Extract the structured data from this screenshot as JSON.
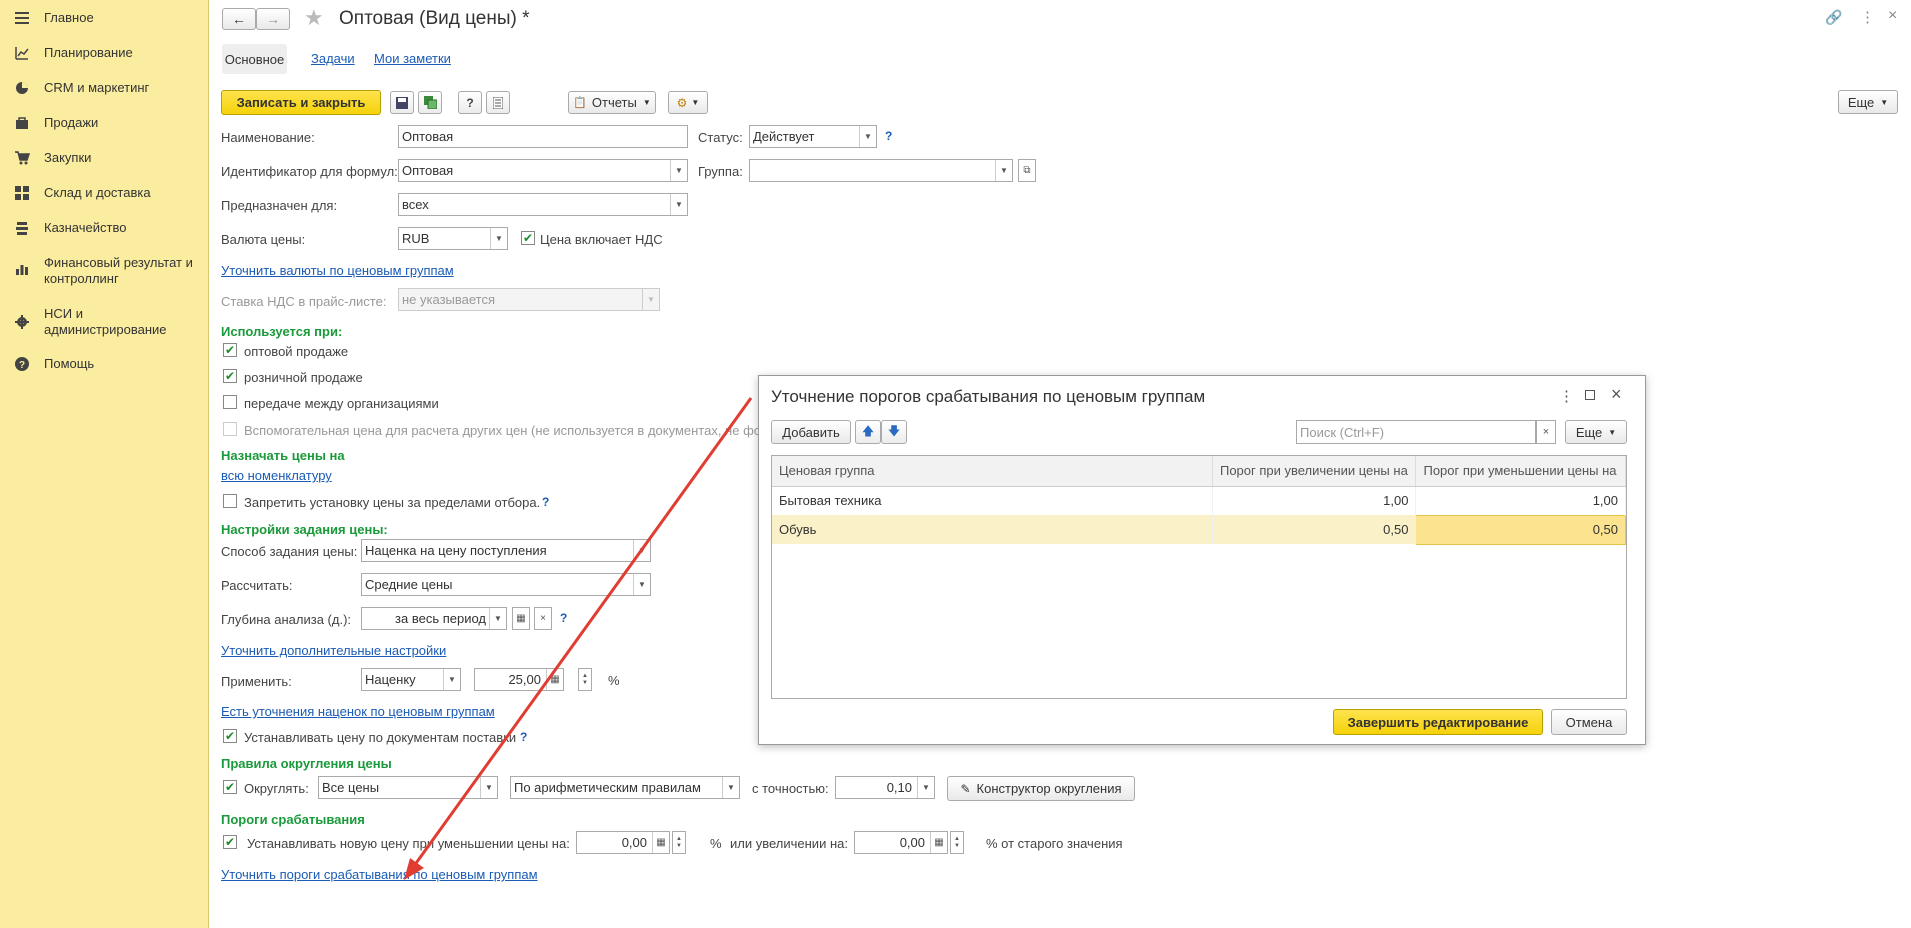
{
  "sidebar": {
    "items": [
      {
        "label": "Главное",
        "icon": "menu-icon"
      },
      {
        "label": "Планирование",
        "icon": "chart-up-icon"
      },
      {
        "label": "CRM и маркетинг",
        "icon": "pie-chart-icon"
      },
      {
        "label": "Продажи",
        "icon": "bag-icon"
      },
      {
        "label": "Закупки",
        "icon": "cart-icon"
      },
      {
        "label": "Склад и доставка",
        "icon": "warehouse-icon"
      },
      {
        "label": "Казначейство",
        "icon": "treasury-icon"
      },
      {
        "label": "Финансовый результат и контроллинг",
        "icon": "bar-chart-icon"
      },
      {
        "label": "НСИ и администрирование",
        "icon": "gear-icon"
      },
      {
        "label": "Помощь",
        "icon": "help-icon"
      }
    ]
  },
  "header": {
    "title": "Оптовая (Вид цены) *",
    "tabs": [
      "Основное",
      "Задачи",
      "Мои заметки"
    ]
  },
  "toolbar": {
    "save_close": "Записать и закрыть",
    "reports": "Отчеты",
    "help": "?",
    "more": "Еще"
  },
  "form": {
    "name_label": "Наименование:",
    "name_value": "Оптовая",
    "status_label": "Статус:",
    "status_value": "Действует",
    "formula_id_label": "Идентификатор для формул:",
    "formula_id_value": "Оптовая",
    "group_label": "Группа:",
    "group_value": "",
    "intended_label": "Предназначен для:",
    "intended_value": "всех",
    "currency_label": "Валюта цены:",
    "currency_value": "RUB",
    "vat_included": "Цена включает НДС",
    "currency_link": "Уточнить валюты по ценовым группам",
    "vat_rate_label": "Ставка НДС в прайс-листе:",
    "vat_rate_value": "не указывается",
    "used_when_header": "Используется при:",
    "used_wholesale": "оптовой продаже",
    "used_retail": "розничной продаже",
    "used_transfer": "передаче между организациями",
    "used_aux": "Вспомогательная цена для расчета других цен (не используется в документах, не фо",
    "assign_header": "Назначать цены на",
    "assign_link": "всю номенклатуру",
    "forbid_label": "Запретить установку цены за пределами отбора.",
    "settings_header": "Настройки задания цены:",
    "method_label": "Способ задания цены:",
    "method_value": "Наценка на цену поступления",
    "calc_label": "Рассчитать:",
    "calc_value": "Средние цены",
    "depth_label": "Глубина анализа (д.):",
    "depth_value": "за весь период",
    "extra_link": "Уточнить дополнительные настройки",
    "apply_label": "Применить:",
    "apply_value": "Наценку",
    "apply_amount": "25,00",
    "percent": "%",
    "markup_link": "Есть уточнения наценок по ценовым группам",
    "set_by_docs": "Устанавливать цену по документам поставки",
    "rounding_header": "Правила округления цены",
    "round_label": "Округлять:",
    "round_scope": "Все цены",
    "round_rule": "По арифметическим правилам",
    "precision_label": "с точностью:",
    "precision_value": "0,10",
    "round_builder": "Конструктор округления",
    "thresholds_header": "Пороги срабатывания",
    "threshold_set_label": "Устанавливать новую цену при уменьшении цены на:",
    "threshold_decrease": "0,00",
    "or_increase_label": "или увеличении на:",
    "threshold_increase": "0,00",
    "of_old_value": "% от старого значения",
    "threshold_link": "Уточнить пороги срабатывания по ценовым группам"
  },
  "dialog": {
    "title": "Уточнение порогов срабатывания по ценовым группам",
    "add": "Добавить",
    "search_placeholder": "Поиск (Ctrl+F)",
    "more": "Еще",
    "columns": [
      "Ценовая группа",
      "Порог при увеличении цены на",
      "Порог при уменьшении цены на"
    ],
    "rows": [
      {
        "group": "Бытовая техника",
        "increase": "1,00",
        "decrease": "1,00"
      },
      {
        "group": "Обувь",
        "increase": "0,50",
        "decrease": "0,50"
      }
    ],
    "finish": "Завершить редактирование",
    "cancel": "Отмена"
  },
  "colors": {
    "sidebar_bg": "#fbeda0",
    "accent_yellow": "#f5d20a",
    "header_green": "#1a9a3a",
    "link_blue": "#1a5bb5",
    "annotation_arrow": "#e03c31"
  }
}
